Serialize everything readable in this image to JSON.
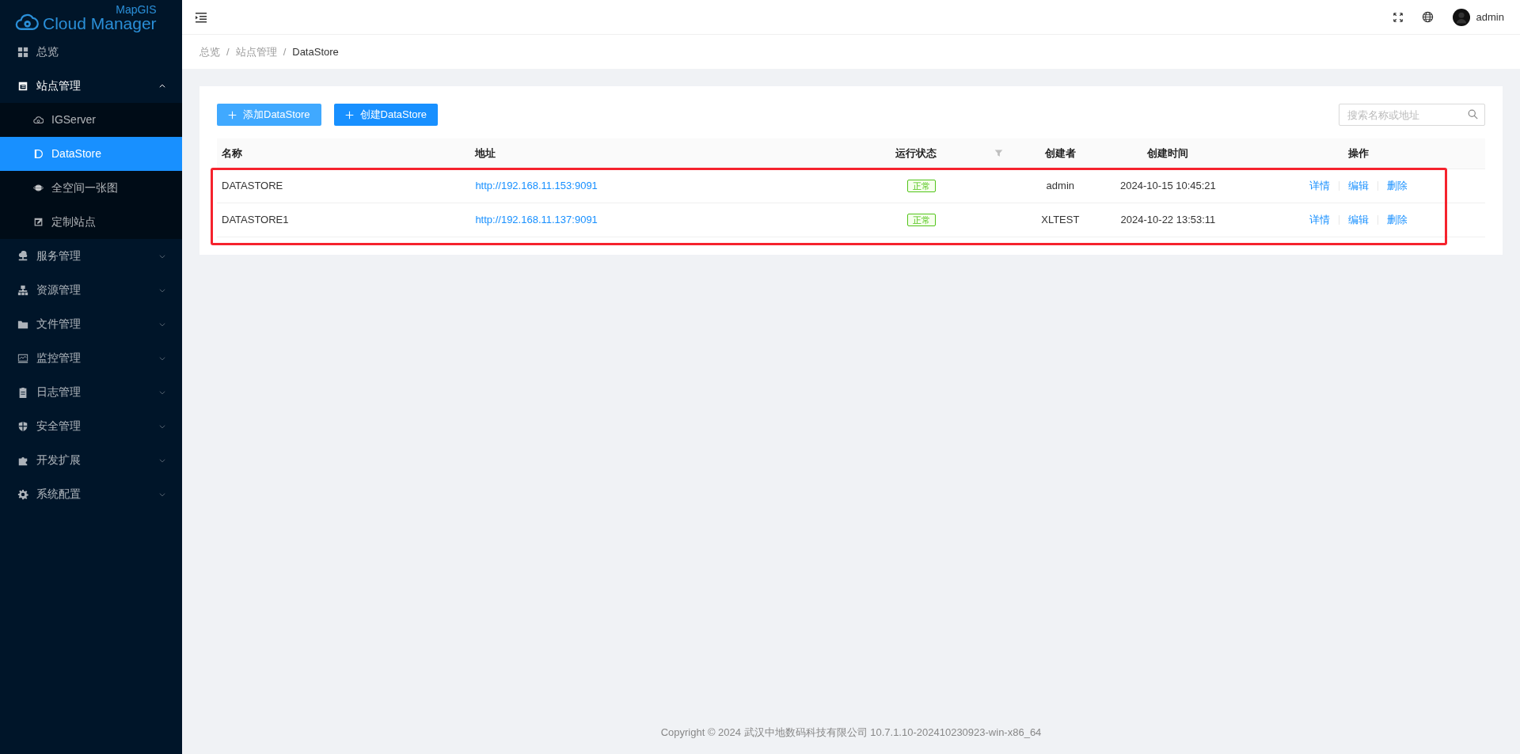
{
  "logo": {
    "subtitle": "MapGIS",
    "title": "Cloud Manager"
  },
  "sidebar": {
    "items": [
      {
        "label": "总览",
        "kind": "link",
        "selected": false
      },
      {
        "label": "站点管理",
        "kind": "group",
        "expanded": true,
        "selected": false,
        "children": [
          {
            "label": "IGServer",
            "selected": false
          },
          {
            "label": "DataStore",
            "selected": true
          },
          {
            "label": "全空间一张图",
            "selected": false
          },
          {
            "label": "定制站点",
            "selected": false
          }
        ]
      },
      {
        "label": "服务管理",
        "kind": "group",
        "expanded": false,
        "selected": false
      },
      {
        "label": "资源管理",
        "kind": "group",
        "expanded": false,
        "selected": false
      },
      {
        "label": "文件管理",
        "kind": "group",
        "expanded": false,
        "selected": false
      },
      {
        "label": "监控管理",
        "kind": "group",
        "expanded": false,
        "selected": false
      },
      {
        "label": "日志管理",
        "kind": "group",
        "expanded": false,
        "selected": false
      },
      {
        "label": "安全管理",
        "kind": "group",
        "expanded": false,
        "selected": false
      },
      {
        "label": "开发扩展",
        "kind": "group",
        "expanded": false,
        "selected": false
      },
      {
        "label": "系统配置",
        "kind": "group",
        "expanded": false,
        "selected": false
      }
    ]
  },
  "header": {
    "user": "admin"
  },
  "breadcrumb": {
    "separator": "/",
    "items": [
      "总览",
      "站点管理",
      "DataStore"
    ]
  },
  "toolbar": {
    "buttons": [
      {
        "label": "添加DataStore",
        "hovered": true
      },
      {
        "label": "创建DataStore",
        "hovered": false
      }
    ],
    "search": {
      "placeholder": "搜索名称或地址"
    }
  },
  "table": {
    "highlight_frame": true,
    "columns": [
      {
        "label": "名称",
        "filterable": false
      },
      {
        "label": "地址",
        "filterable": false
      },
      {
        "label": "运行状态",
        "filterable": true
      },
      {
        "label": "创建者",
        "filterable": false
      },
      {
        "label": "创建时间",
        "filterable": false
      },
      {
        "label": "操作",
        "filterable": false
      }
    ],
    "rows": [
      {
        "name": "DATASTORE",
        "address": "http://192.168.11.153:9091",
        "status": "正常",
        "color": "#52c41a",
        "creator": "admin",
        "created": "2024-10-15 10:45:21",
        "actions": [
          "详情",
          "编辑",
          "删除"
        ]
      },
      {
        "name": "DATASTORE1",
        "address": "http://192.168.11.137:9091",
        "status": "正常",
        "color": "#52c41a",
        "creator": "XLTEST",
        "created": "2024-10-22 13:53:11",
        "actions": [
          "详情",
          "编辑",
          "删除"
        ]
      }
    ]
  },
  "footer": "Copyright © 2024 武汉中地数码科技有限公司 10.7.1.10-202410230923-win-x86_64"
}
